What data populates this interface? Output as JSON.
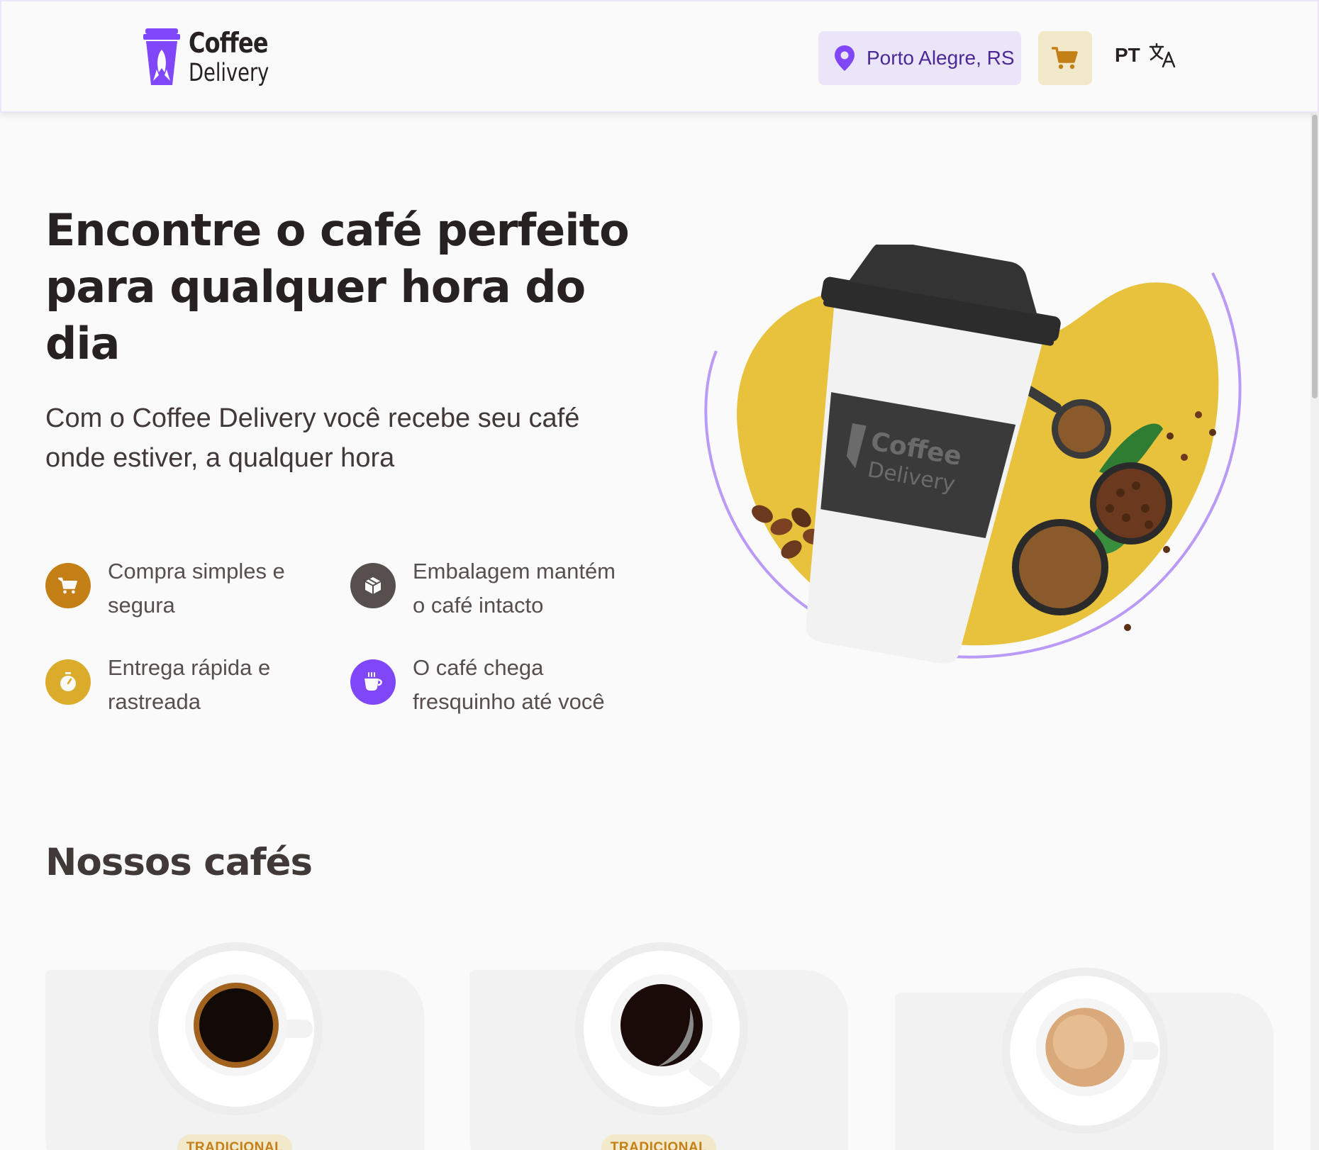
{
  "header": {
    "logo": {
      "line1": "Coffee",
      "line2": "Delivery"
    },
    "location": "Porto Alegre, RS",
    "language": "PT"
  },
  "hero": {
    "title": "Encontre o café perfeito para qualquer hora do dia",
    "subtitle": "Com o Coffee Delivery você recebe seu café onde estiver, a qualquer hora",
    "benefits": [
      {
        "text": "Compra simples e segura",
        "icon": "cart-icon",
        "color": "#C47F17"
      },
      {
        "text": "Embalagem mantém o café intacto",
        "icon": "package-icon",
        "color": "#574F4D"
      },
      {
        "text": "Entrega rápida e rastreada",
        "icon": "timer-icon",
        "color": "#DBAC2C"
      },
      {
        "text": "O café chega fresquinho até você",
        "icon": "coffee-icon",
        "color": "#8047F8"
      }
    ],
    "cup_logo": {
      "line1": "Coffee",
      "line2": "Delivery"
    }
  },
  "catalog": {
    "title": "Nossos cafés",
    "cards": [
      {
        "tag": "TRADICIONAL",
        "image": "espresso-cup"
      },
      {
        "tag": "TRADICIONAL",
        "image": "americano-cup"
      },
      {
        "tag": "",
        "image": "cream-espresso-cup"
      }
    ]
  },
  "colors": {
    "brand_purple": "#8047F8",
    "purple_light": "#EBE5F9",
    "purple_dark": "#4B2995",
    "yellow": "#DBAC2C",
    "yellow_dark": "#C47F17",
    "yellow_light": "#F1E9C9",
    "background": "#FAFAFA"
  }
}
